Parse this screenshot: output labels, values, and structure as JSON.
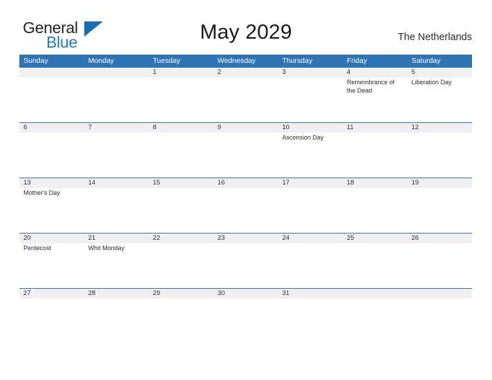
{
  "brand": {
    "name_part1": "General",
    "name_part2": "Blue",
    "triangle_color": "#1b6cb0",
    "blue_color": "#1f7ac4"
  },
  "header": {
    "title": "May 2029",
    "region": "The Netherlands"
  },
  "calendar": {
    "accent_color": "#2e74b5",
    "daynum_band_color": "#f0f0f0",
    "weekdays": [
      "Sunday",
      "Monday",
      "Tuesday",
      "Wednesday",
      "Thursday",
      "Friday",
      "Saturday"
    ],
    "weeks": [
      {
        "days": [
          {
            "date": "",
            "event": ""
          },
          {
            "date": "",
            "event": ""
          },
          {
            "date": "1",
            "event": ""
          },
          {
            "date": "2",
            "event": ""
          },
          {
            "date": "3",
            "event": ""
          },
          {
            "date": "4",
            "event": "Remembrance of the Dead"
          },
          {
            "date": "5",
            "event": "Liberation Day"
          }
        ]
      },
      {
        "days": [
          {
            "date": "6",
            "event": ""
          },
          {
            "date": "7",
            "event": ""
          },
          {
            "date": "8",
            "event": ""
          },
          {
            "date": "9",
            "event": ""
          },
          {
            "date": "10",
            "event": "Ascension Day"
          },
          {
            "date": "11",
            "event": ""
          },
          {
            "date": "12",
            "event": ""
          }
        ]
      },
      {
        "days": [
          {
            "date": "13",
            "event": "Mother's Day"
          },
          {
            "date": "14",
            "event": ""
          },
          {
            "date": "15",
            "event": ""
          },
          {
            "date": "16",
            "event": ""
          },
          {
            "date": "17",
            "event": ""
          },
          {
            "date": "18",
            "event": ""
          },
          {
            "date": "19",
            "event": ""
          }
        ]
      },
      {
        "days": [
          {
            "date": "20",
            "event": "Pentecost"
          },
          {
            "date": "21",
            "event": "Whit Monday"
          },
          {
            "date": "22",
            "event": ""
          },
          {
            "date": "23",
            "event": ""
          },
          {
            "date": "24",
            "event": ""
          },
          {
            "date": "25",
            "event": ""
          },
          {
            "date": "26",
            "event": ""
          }
        ]
      },
      {
        "days": [
          {
            "date": "27",
            "event": ""
          },
          {
            "date": "28",
            "event": ""
          },
          {
            "date": "29",
            "event": ""
          },
          {
            "date": "30",
            "event": ""
          },
          {
            "date": "31",
            "event": ""
          },
          {
            "date": "",
            "event": ""
          },
          {
            "date": "",
            "event": ""
          }
        ]
      }
    ]
  }
}
